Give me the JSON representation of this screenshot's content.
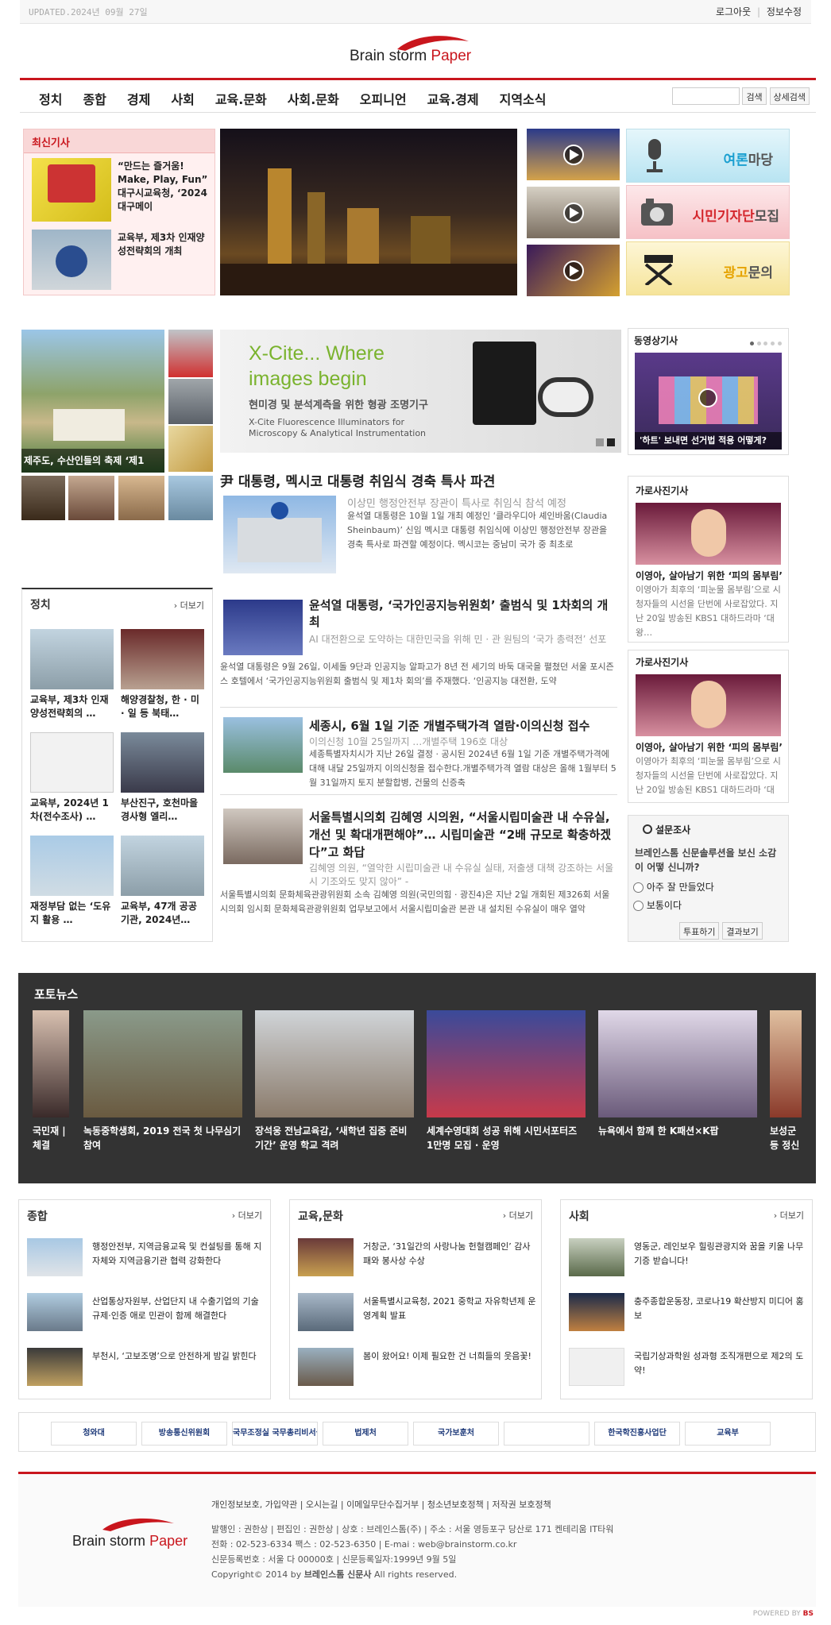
{
  "topbar": {
    "updated": "UPDATED.2024년 09월 27일",
    "logout": "로그아웃",
    "info_edit": "정보수정"
  },
  "logo": {
    "brand_a": "Brain",
    "brand_b": "storm",
    "brand_c": "Paper"
  },
  "menu": [
    "정치",
    "종합",
    "경제",
    "사회",
    "교육.문화",
    "사회.문화",
    "오피니언",
    "교육.경제",
    "지역소식"
  ],
  "search": {
    "btn": "검색",
    "detail": "상세검색"
  },
  "latest": {
    "title": "최신기사",
    "items": [
      {
        "text": "“만드는 즐거움! Make, Play, Fun” 대구시교육청, ‘2024 대구메이"
      },
      {
        "text": "교육부, 제3차 인재양성전략회의 개최"
      }
    ]
  },
  "side_banners": [
    {
      "title_a": "여론",
      "title_b": "마당"
    },
    {
      "title_a": "시민기자단",
      "title_b": "모집"
    },
    {
      "title_a": "광고",
      "title_b": "문의"
    }
  ],
  "photo_caption": "제주도, 수산인들의 축제 ‘제1",
  "xcite": {
    "line1": "X-Cite... Where",
    "line2": "images begin",
    "sub": "현미경 및 분석계측을 위한 형광 조명기구",
    "eng1": "X-Cite Fluorescence Illuminators for",
    "eng2": "Microscopy & Analytical Instrumentation"
  },
  "headline": {
    "title": "尹 대통령, 멕시코 대통령 취임식 경축 특사 파견",
    "sub": "이상민 행정안전부 장관이 특사로 취임식 참석 예정",
    "body": "윤석열 대통령은 10월 1일 개최 예정인 ‘클라우디아 셰인바움(Claudia Sheinbaum)’ 신임 멕시코 대통령 취임식에 이상민 행정안전부 장관을 경축 특사로 파견할 예정이다. 멕시코는 중남미 국가 중 최초로"
  },
  "politics": {
    "title": "정치",
    "more": "› 더보기",
    "items": [
      {
        "text": "교육부, 제3차 인재양성전략회의 …"
      },
      {
        "text": "해양경찰청, 한 · 미 · 일 등 북태…"
      },
      {
        "text": "교육부, 2024년 1차(전수조사) …"
      },
      {
        "text": "부산진구, 호천마을 경사형 엘리…"
      },
      {
        "text": "재정부담 없는 ‘도유지 활용 …"
      },
      {
        "text": "교육부, 47개 공공기관, 2024년…"
      }
    ]
  },
  "articles": [
    {
      "title": "윤석열 대통령, ‘국가인공지능위원회’ 출범식 및 1차회의 개최",
      "sub": "AI 대전환으로 도약하는 대한민국을 위해 민 · 관 원팀의 ‘국가 총력전’ 선포",
      "body": "윤석열 대통령은 9월 26일, 이세돌 9단과 인공지능 알파고가 8년 전 세기의 바둑 대국을 펼쳤던 서울 포시즌스 호텔에서 ‘국가인공지능위원회 출범식 및 제1차 회의’를 주재했다. ‘인공지능 대전환, 도약"
    },
    {
      "title": "세종시, 6월 1일 기준 개별주택가격 열람·이의신청 접수",
      "sub": "이의신청 10월 25일까지 …개별주택 196호 대상",
      "body": "세종특별자치시가 지난 26일 결정 · 공시된 2024년 6월 1일 기준 개별주택가격에 대해 내달 25일까지 이의신청을 접수한다.개별주택가격 열람 대상은 올해 1월부터 5월 31일까지 토지 분할합병, 건물의 신증축"
    },
    {
      "title": "서울특별시의회 김혜영 시의원, “서울시립미술관 내 수유실, 개선 및 확대개편해야”… 시립미술관 “2배 규모로 확충하겠다”고 화답",
      "sub": "김혜영 의원, “열악한 시립미술관 내 수유실 실태, 저출생 대책 강조하는 서울시 기조와도 맞지 않아” -",
      "body": "서울특별시의회 문화체육관광위원회 소속 김혜영 의원(국민의힘 · 광진4)은 지난 2일 개회된 제326회 서울시의회 임시회 문화체육관광위원회 업무보고에서 서울시립미술관 본관 내 설치된 수유실이 매우 열악"
    }
  ],
  "video": {
    "title": "동영상기사",
    "caption": "'하트' 보내면 선거법 적용 어떻게?"
  },
  "street_photo": [
    {
      "title": "가로사진기사",
      "caption": "이영아, 살아남기 위한 ‘피의 몸부림’",
      "body": "이영아가 최후의 ‘피눈물 몸부림’으로 시청자들의 시선을 단번에 사로잡았다. 지난 20일 방송된 KBS1 대하드라마 ‘대왕…"
    },
    {
      "title": "가로사진기사",
      "caption": "이영아, 살아남기 위한 ‘피의 몸부림’",
      "body": "이영아가 최후의 ‘피눈물 몸부림’으로 시청자들의 시선을 단번에 사로잡았다. 지난 20일 방송된 KBS1 대하드라마 ‘대왕…"
    }
  ],
  "poll": {
    "title": "설문조사",
    "question": "브레인스톰 신문솔루션을 보신 소감이 어떻 신니까?",
    "options": [
      "아주 잘 만들었다",
      "보통이다"
    ],
    "vote": "투표하기",
    "result": "결과보기"
  },
  "photo_news": {
    "title": "포토뉴스",
    "items": [
      {
        "text": "국민재 | 체결"
      },
      {
        "text": "녹동중학생회, 2019 전국 첫 나무심기 참여"
      },
      {
        "text": "장석웅 전남교육감, ‘새학년 집중 준비기간’ 운영 학교 격려"
      },
      {
        "text": "세계수영대회 성공 위해 시민서포터즈 1만명 모집 · 운영"
      },
      {
        "text": "뉴욕에서 함께 한 K패션×K팝"
      },
      {
        "text": "보성군 등 정신"
      }
    ]
  },
  "bottom_sections": [
    {
      "title": "종합",
      "more": "› 더보기",
      "items": [
        "행정안전부, 지역금융교육 및 컨설팅를 통해 지자체와 지역금융기관 협력 강화한다",
        "산업통상자원부, 산업단지 내 수출기업의 기술규제·인증 애로 민관이 함께 해결한다",
        "부천시, ‘고보조명’으로 안전하게 밤길 밝힌다"
      ]
    },
    {
      "title": "교육,문화",
      "more": "› 더보기",
      "items": [
        "거창군, ‘31일간의 사랑나눔 헌혈캠페인’ 감사패와 봉사상 수상",
        "서울특별시교육청, 2021 중학교 자유학년제 운영계획 발표",
        "봄이 왔어요! 이제 필요한 건 너희들의 웃음꽃!"
      ]
    },
    {
      "title": "사회",
      "more": "› 더보기",
      "items": [
        "영동군, 레인보우 힐링관광지와 꿈을 키울 나무기증 받습니다!",
        "충주종합운동장, 코로나19 확산방지 미디어 홍보",
        "국립기상과학원 성과형 조직개편으로 제2의 도약!"
      ]
    }
  ],
  "partners": [
    "청와대",
    "방송통신위원회",
    "국무조정실 국무총리비서실",
    "법제처",
    "국가보훈처",
    "",
    "한국학진흥사업단",
    "교육부"
  ],
  "footer": {
    "links": "개인정보보호, 가입약관 | 오시는길 | 이메일무단수집거부 | 청소년보호정책 | 저작권 보호정책",
    "line1": "발행인 : 권한상 | 편집인 : 권한상 | 상호 : 브레인스톰(주) | 주소 : 서울 영등포구 당산로 171 켄테리움 IT타워",
    "line2": "전화 : 02-523-6334 팩스 : 02-523-6350 | E-mai : web@brainstorm.co.kr",
    "line3": "신문등록번호 : 서울 다 00000호 | 신문등록일자:1999년 9월 5일",
    "line4a": "Copyright© 2014 by",
    "line4b": "브레인스톰 신문사",
    "line4c": "All rights reserved.",
    "powered": "POWERED BY",
    "powered_bs": "BS"
  },
  "colors": {
    "accent": "#c9161d",
    "dark": "#333333"
  }
}
